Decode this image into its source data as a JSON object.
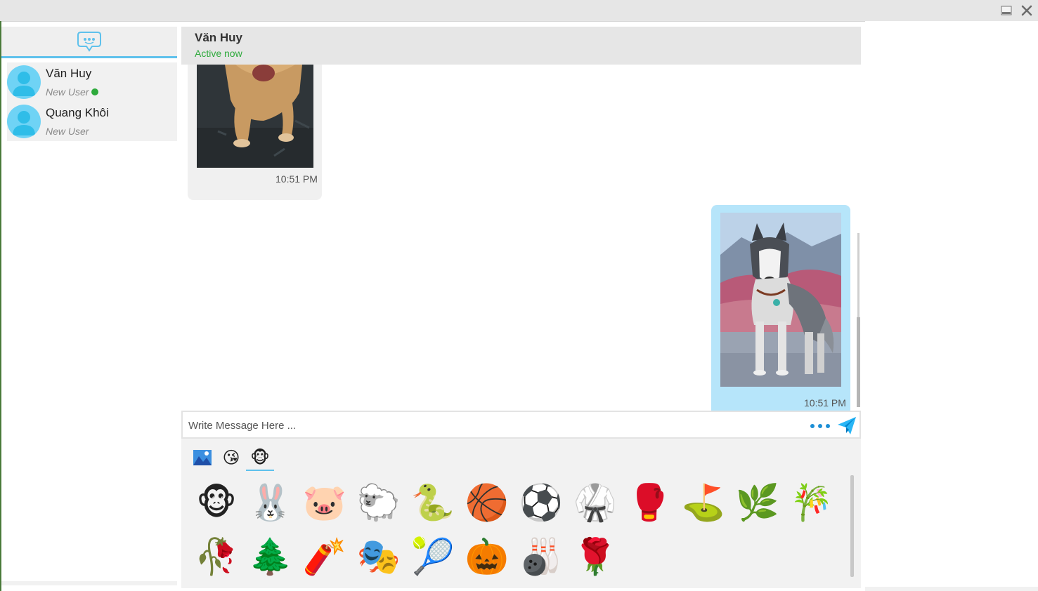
{
  "window": {
    "minimize_icon": "minimize-icon",
    "close_icon": "close-icon"
  },
  "sidebar": {
    "logo_icon": "chat-bubble-logo-icon",
    "contacts": [
      {
        "name": "Văn Huy",
        "subtitle": "New User",
        "online": true
      },
      {
        "name": "Quang Khôi",
        "subtitle": "New User",
        "online": false
      }
    ]
  },
  "chat": {
    "name": "Văn Huy",
    "status": "Active now",
    "messages": [
      {
        "direction": "incoming",
        "type": "image",
        "image": "dog-photo",
        "time": "10:51 PM"
      },
      {
        "direction": "outgoing",
        "type": "image",
        "image": "husky-photo",
        "time": "10:51 PM"
      }
    ]
  },
  "composer": {
    "placeholder": "Write Message Here ...",
    "value": "",
    "more_icon": "more-dots-icon",
    "send_icon": "send-icon"
  },
  "emoji_tabs": [
    {
      "name": "image-tab",
      "glyph": "🏞"
    },
    {
      "name": "face-tab",
      "glyph": "😘"
    },
    {
      "name": "animal-tab",
      "glyph": "🐵",
      "active": true
    }
  ],
  "emojis": [
    "🐵",
    "🐰",
    "🐷",
    "🐑",
    "🐍",
    "🏀",
    "⚽",
    "🥋",
    "🥊",
    "⛳",
    "🌿",
    "🎋",
    "🥀",
    "🌲",
    "🧨",
    "🎭",
    "🎾",
    "🎃",
    "🎳",
    "🌹"
  ],
  "colors": {
    "accent": "#5ec1ec",
    "online": "#2eaa3c",
    "outgoing_bubble": "#b6e5fa",
    "incoming_bubble": "#f0f0f0"
  }
}
